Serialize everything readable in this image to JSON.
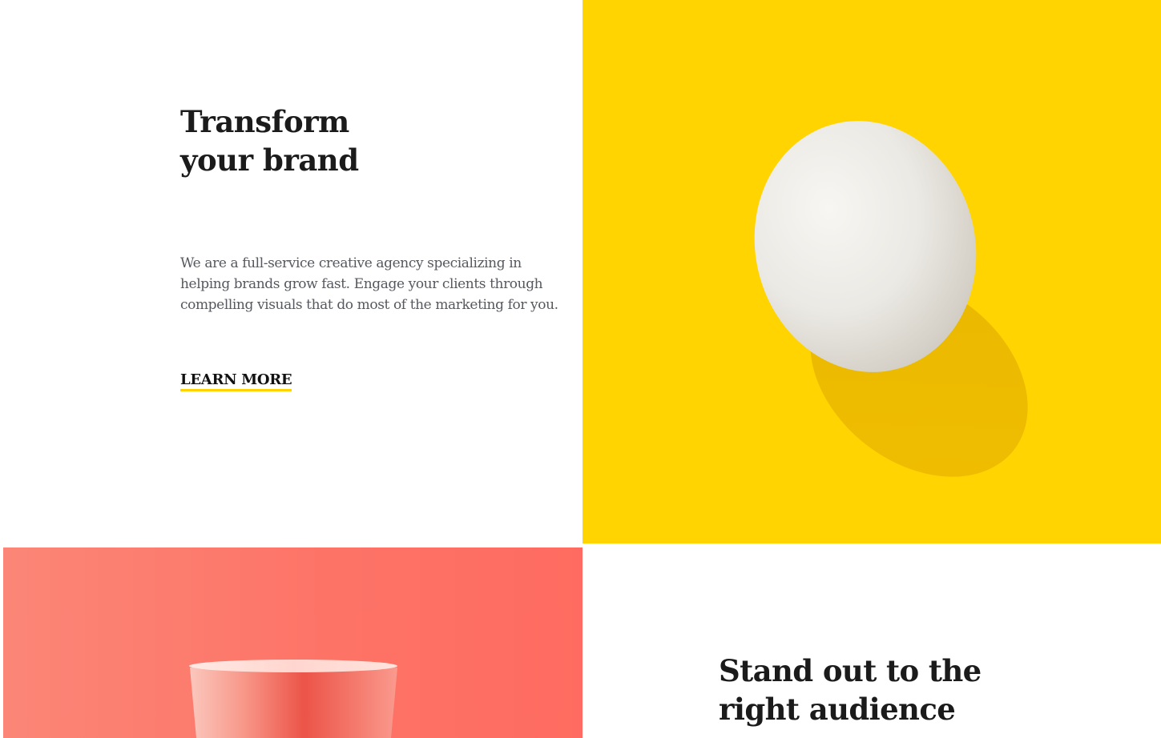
{
  "hero": {
    "title": "Transform your brand",
    "description": "We are a full-service creative agency specializing in helping brands grow fast. Engage your clients through compelling visuals that do most of the marketing for you.",
    "cta_label": "LEARN MORE"
  },
  "features": {
    "second_title": "Stand out to the right audience"
  },
  "colors": {
    "accent_yellow": "#ffd400",
    "coral": "#fd7467",
    "heading_text": "#1b1b1b",
    "body_text": "#55595f"
  },
  "images": {
    "egg_image": "egg-on-yellow-image",
    "cup_image": "coral-cup-image"
  }
}
